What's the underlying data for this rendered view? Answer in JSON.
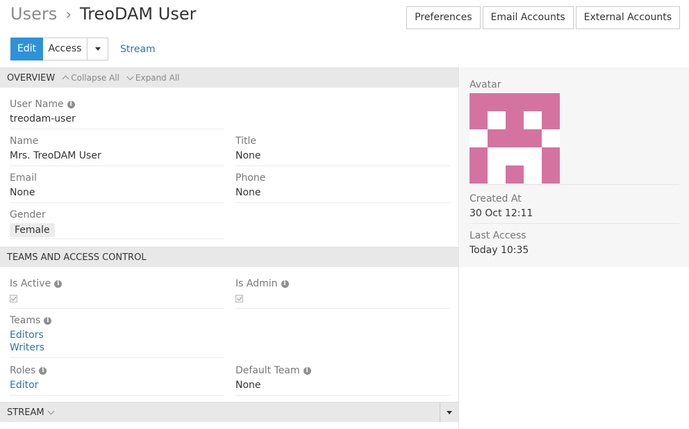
{
  "breadcrumb": {
    "parent": "Users",
    "separator": "›",
    "current": "TreoDAM User"
  },
  "header_buttons": [
    "Preferences",
    "Email Accounts",
    "External Accounts"
  ],
  "actions": {
    "edit": "Edit",
    "access": "Access",
    "stream": "Stream"
  },
  "overview": {
    "title": "OVERVIEW",
    "collapse_all": "Collapse All",
    "expand_all": "Expand All",
    "user_name_label": "User Name",
    "user_name": "treodam-user",
    "name_label": "Name",
    "name": "Mrs. TreoDAM User",
    "title_label": "Title",
    "title_value": "None",
    "email_label": "Email",
    "email": "None",
    "phone_label": "Phone",
    "phone": "None",
    "gender_label": "Gender",
    "gender": "Female"
  },
  "teams_access": {
    "title": "TEAMS AND ACCESS CONTROL",
    "is_active_label": "Is Active",
    "is_admin_label": "Is Admin",
    "is_active": true,
    "is_admin": true,
    "teams_label": "Teams",
    "teams": [
      "Editors",
      "Writers"
    ],
    "roles_label": "Roles",
    "roles": [
      "Editor"
    ],
    "default_team_label": "Default Team",
    "default_team": "None"
  },
  "stream_panel": {
    "title": "STREAM"
  },
  "side": {
    "avatar_label": "Avatar",
    "avatar_color": "#d4739f",
    "created_at_label": "Created At",
    "created_at": "30 Oct 12:11",
    "last_access_label": "Last Access",
    "last_access": "Today 10:35"
  },
  "icons": {
    "info": "info-icon",
    "caret": "caret-down-icon",
    "collapse": "chevron-up-icon",
    "expand": "chevron-down-icon"
  }
}
